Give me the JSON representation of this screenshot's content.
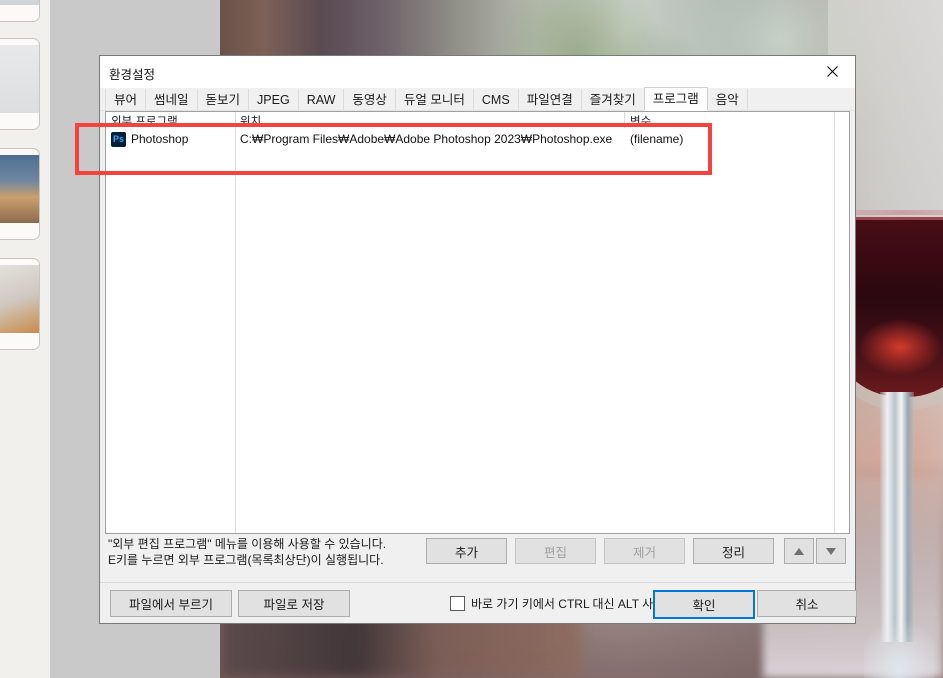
{
  "dialog": {
    "title": "환경설정",
    "close_icon": "close-icon",
    "tabs": [
      {
        "label": "뷰어",
        "active": false
      },
      {
        "label": "썸네일",
        "active": false
      },
      {
        "label": "돋보기",
        "active": false
      },
      {
        "label": "JPEG",
        "active": false
      },
      {
        "label": "RAW",
        "active": false
      },
      {
        "label": "동영상",
        "active": false
      },
      {
        "label": "듀얼 모니터",
        "active": false
      },
      {
        "label": "CMS",
        "active": false
      },
      {
        "label": "파일연결",
        "active": false
      },
      {
        "label": "즐겨찾기",
        "active": false
      },
      {
        "label": "프로그램",
        "active": true
      },
      {
        "label": "음악",
        "active": false
      }
    ],
    "list": {
      "columns": [
        "외부 프로그램",
        "위치",
        "변수"
      ],
      "rows": [
        {
          "icon": "photoshop-icon",
          "icon_text": "Ps",
          "name": "Photoshop",
          "path": "C:₩Program Files₩Adobe₩Adobe Photoshop 2023₩Photoshop.exe",
          "variable": "(filename)"
        }
      ]
    },
    "hints": [
      "\"외부 편집 프로그램\" 메뉴를 이용해 사용할 수 있습니다.",
      "E키를 누르면 외부 프로그램(목록최상단)이 실행됩니다."
    ],
    "list_buttons": [
      {
        "label": "추가",
        "disabled": false
      },
      {
        "label": "편집",
        "disabled": true
      },
      {
        "label": "제거",
        "disabled": true
      },
      {
        "label": "정리",
        "disabled": false
      }
    ],
    "move_buttons": [
      {
        "icon": "arrow-up-icon"
      },
      {
        "icon": "arrow-down-icon"
      }
    ],
    "footer": {
      "load_label": "파일에서 부르기",
      "save_label": "파일로 저장",
      "checkbox_label": "바로 가기 키에서 CTRL 대신 ALT 사용",
      "checkbox_checked": false,
      "ok_label": "확인",
      "cancel_label": "취소"
    }
  },
  "annotation": {
    "color": "#f4433c",
    "shape": "rectangle"
  },
  "background": {
    "filmstrip_caption": "≡",
    "photo_subject": "wine-glass-photo"
  }
}
